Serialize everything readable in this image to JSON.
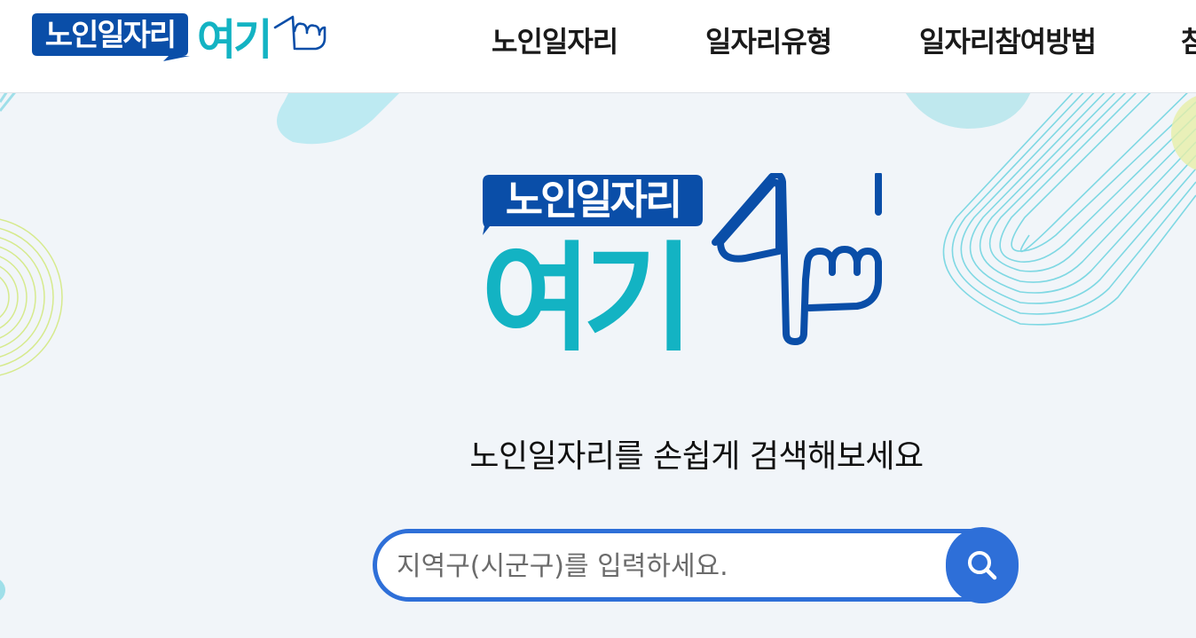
{
  "brand": {
    "logo_top_text": "노인일자리",
    "logo_bottom_text": "여기"
  },
  "nav": {
    "items": [
      {
        "label": "노인일자리"
      },
      {
        "label": "일자리유형"
      },
      {
        "label": "일자리참여방법"
      },
      {
        "label": "참"
      }
    ]
  },
  "hero": {
    "tagline": "노인일자리를 손쉽게 검색해보세요"
  },
  "search": {
    "placeholder": "지역구(시군구)를 입력하세요.",
    "button_icon": "search-icon"
  },
  "colors": {
    "brand_blue": "#0a4ea8",
    "brand_teal": "#13b3c3",
    "accent_blue": "#2e6fd8",
    "hero_background": "#f1f5f9"
  }
}
